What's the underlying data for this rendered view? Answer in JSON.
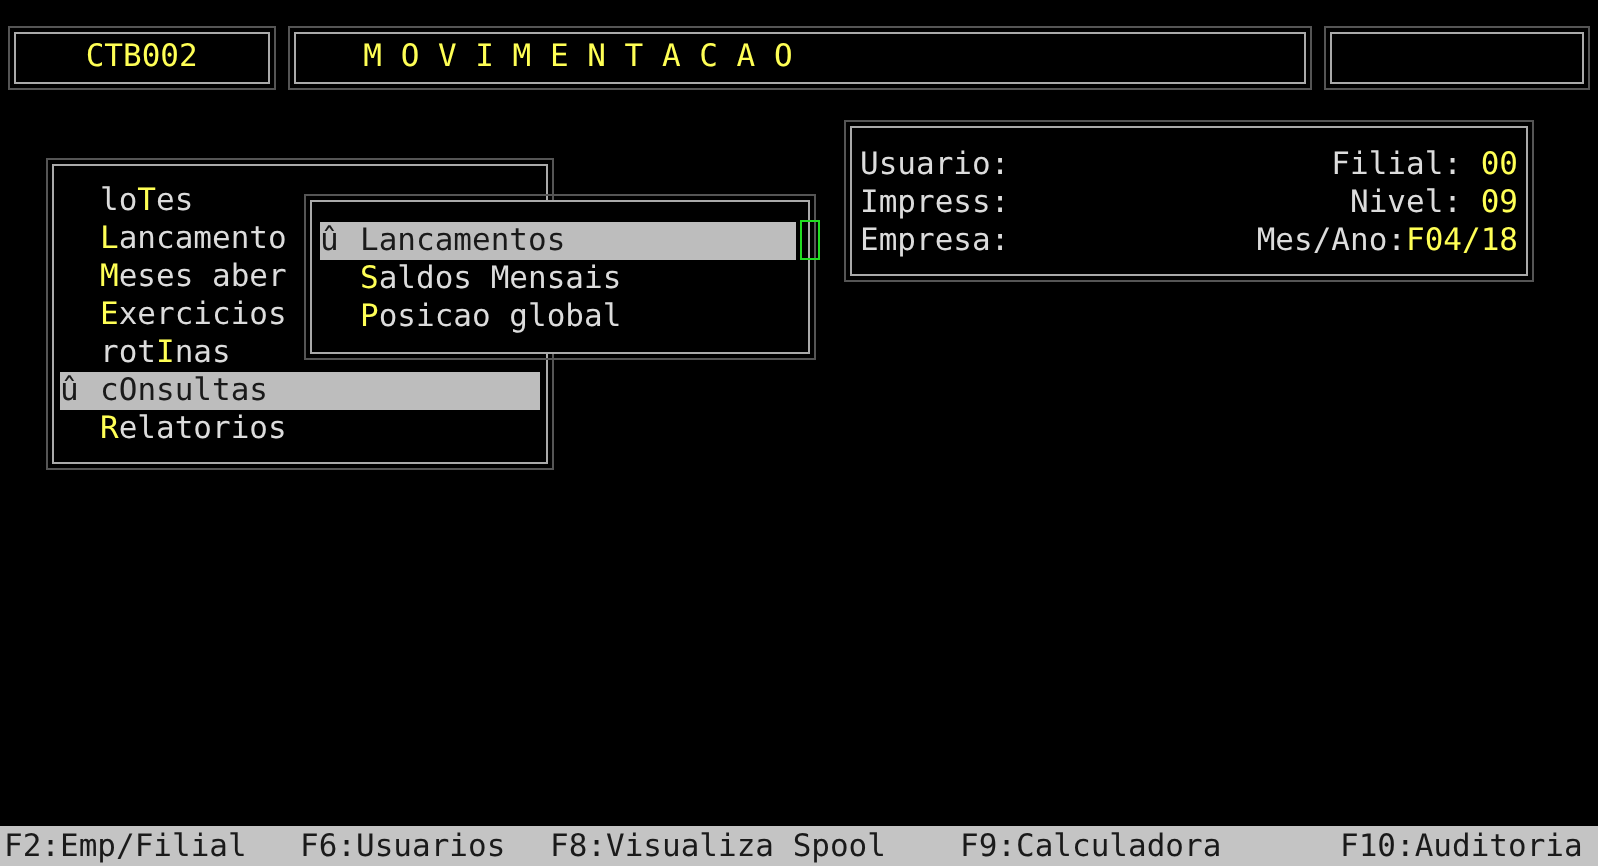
{
  "header": {
    "program": "CTB002",
    "title": "M O V I M E N T A C A O"
  },
  "menu": {
    "items": [
      {
        "before": "lo",
        "hotkey": "T",
        "after": "es",
        "selected": false
      },
      {
        "hotkey": "L",
        "after": "ancamento",
        "selected": false
      },
      {
        "hotkey": "M",
        "after": "eses aber",
        "selected": false
      },
      {
        "hotkey": "E",
        "after": "xercicios",
        "selected": false
      },
      {
        "before": "rot",
        "hotkey": "I",
        "after": "nas",
        "selected": false
      },
      {
        "before": "c",
        "hotkey": "O",
        "after": "nsultas",
        "selected": true,
        "marker": "û"
      },
      {
        "hotkey": "R",
        "after": "elatorios",
        "selected": false
      }
    ]
  },
  "submenu": {
    "items": [
      {
        "hotkey": "L",
        "after": "ancamentos",
        "selected": true,
        "marker": "û"
      },
      {
        "hotkey": "S",
        "after": "aldos Mensais",
        "selected": false
      },
      {
        "hotkey": "P",
        "after": "osicao global",
        "selected": false
      }
    ]
  },
  "info": {
    "rows": [
      {
        "label": "Usuario:",
        "field": "Filial: ",
        "value": "00"
      },
      {
        "label": "Impress:",
        "field": "Nivel: ",
        "value": "09"
      },
      {
        "label": "Empresa:",
        "field": "Mes/Ano:",
        "value": "F04/18"
      }
    ]
  },
  "status_bar": [
    "F2:Emp/Filial",
    "F6:Usuarios",
    "F8:Visualiza Spool",
    "F9:Calculadora",
    "F10:Auditoria"
  ]
}
